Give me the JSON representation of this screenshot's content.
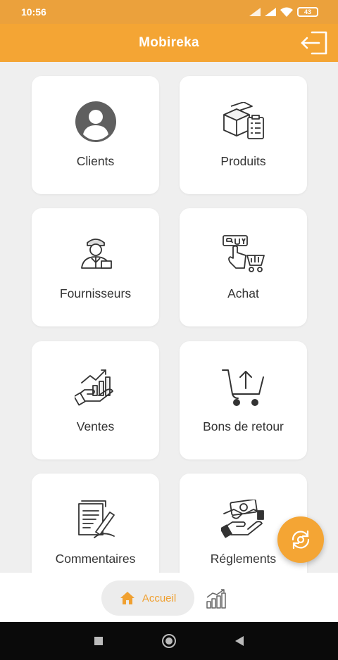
{
  "status": {
    "time": "10:56",
    "battery": "43"
  },
  "app": {
    "title": "Mobireka"
  },
  "menu": [
    {
      "label": "Clients",
      "icon": "user-circle-icon"
    },
    {
      "label": "Produits",
      "icon": "boxes-clipboard-icon"
    },
    {
      "label": "Fournisseurs",
      "icon": "supplier-person-icon"
    },
    {
      "label": "Achat",
      "icon": "buy-cart-icon"
    },
    {
      "label": "Ventes",
      "icon": "sales-growth-hand-icon"
    },
    {
      "label": "Bons de retour",
      "icon": "cart-return-icon"
    },
    {
      "label": "Commentaires",
      "icon": "document-pen-icon"
    },
    {
      "label": "Réglements",
      "icon": "money-handshake-icon"
    }
  ],
  "bottom_nav": {
    "home_label": "Accueil"
  },
  "colors": {
    "primary": "#f4a534",
    "statusbar": "#eba13c",
    "background": "#efefef"
  }
}
